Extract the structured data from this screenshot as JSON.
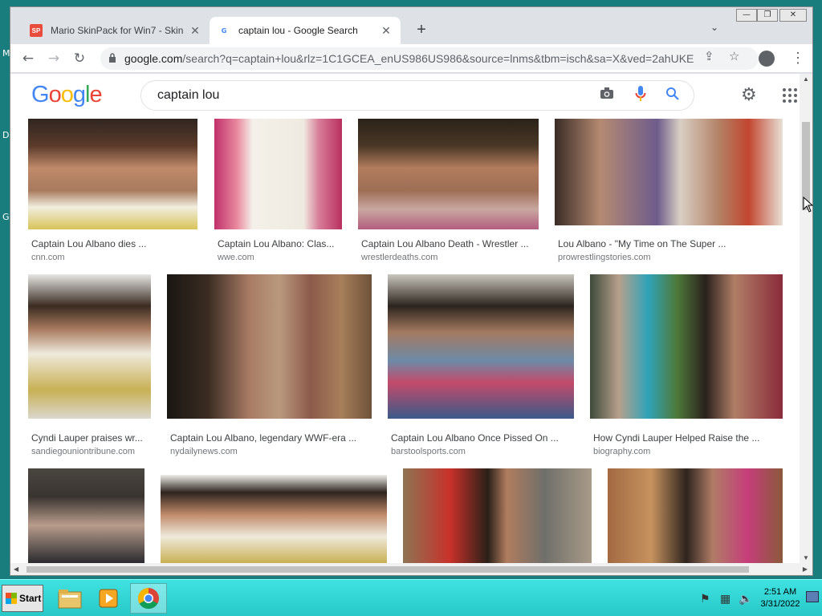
{
  "desktop": {
    "letters": [
      "M",
      "D",
      "G"
    ]
  },
  "window_controls": {
    "minimize": "—",
    "restore": "❐",
    "close": "✕"
  },
  "tabs": [
    {
      "title": "Mario SkinPack for Win7 - Skin Pack",
      "favicon": "SP",
      "active": false
    },
    {
      "title": "captain lou - Google Search",
      "favicon": "G",
      "active": true
    }
  ],
  "toolbar": {
    "url_host": "google.com",
    "url_path": "/search?q=captain+lou&rlz=1C1GCEA_enUS986US986&source=lnms&tbm=isch&sa=X&ved=2ahUKE..."
  },
  "search": {
    "logo": [
      "G",
      "o",
      "o",
      "g",
      "l",
      "e"
    ],
    "query": "captain lou"
  },
  "results": [
    {
      "caption": "Captain Lou Albano dies ...",
      "source": "cnn.com"
    },
    {
      "caption": "Captain Lou Albano: Clas...",
      "source": "wwe.com"
    },
    {
      "caption": "Captain Lou Albano Death - Wrestler ...",
      "source": "wrestlerdeaths.com"
    },
    {
      "caption": "Lou Albano - \"My Time on The Super ...",
      "source": "prowrestlingstories.com"
    },
    {
      "caption": "Cyndi Lauper praises wr...",
      "source": "sandiegouniontribune.com"
    },
    {
      "caption": "Captain Lou Albano, legendary WWF-era ...",
      "source": "nydailynews.com"
    },
    {
      "caption": "Captain Lou Albano Once Pissed On ...",
      "source": "barstoolsports.com"
    },
    {
      "caption": "How Cyndi Lauper Helped Raise the ...",
      "source": "biography.com"
    },
    {
      "caption": "",
      "source": ""
    },
    {
      "caption": "",
      "source": ""
    },
    {
      "caption": "",
      "source": ""
    },
    {
      "caption": "",
      "source": ""
    }
  ],
  "taskbar": {
    "start_label": "Start",
    "clock_time": "2:51 AM",
    "clock_date": "3/31/2022"
  }
}
